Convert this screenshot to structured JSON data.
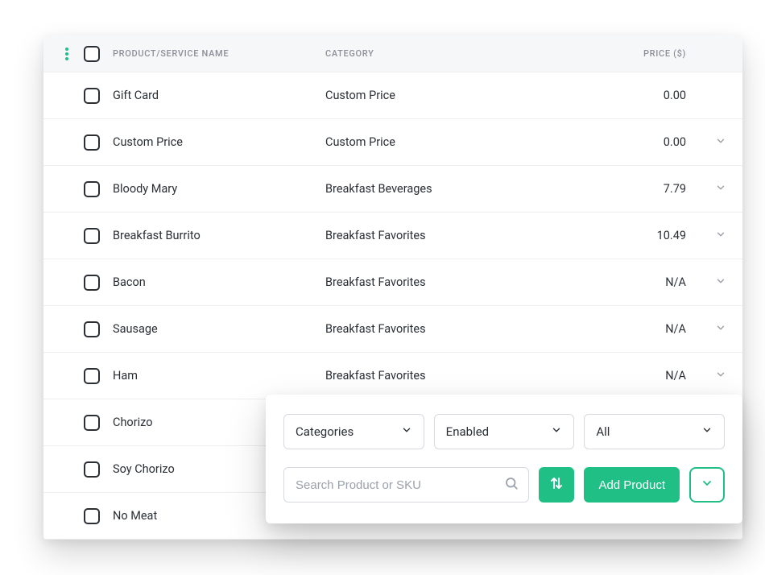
{
  "table": {
    "headers": {
      "name": "PRODUCT/SERVICE NAME",
      "category": "CATEGORY",
      "price": "PRICE ($)"
    },
    "rows": [
      {
        "name": "Gift Card",
        "category": "Custom Price",
        "price": "0.00",
        "expandable": false
      },
      {
        "name": "Custom Price",
        "category": "Custom Price",
        "price": "0.00",
        "expandable": true
      },
      {
        "name": "Bloody Mary",
        "category": "Breakfast Beverages",
        "price": "7.79",
        "expandable": true
      },
      {
        "name": "Breakfast Burrito",
        "category": "Breakfast Favorites",
        "price": "10.49",
        "expandable": true
      },
      {
        "name": "Bacon",
        "category": "Breakfast Favorites",
        "price": "N/A",
        "expandable": true
      },
      {
        "name": "Sausage",
        "category": "Breakfast Favorites",
        "price": "N/A",
        "expandable": true
      },
      {
        "name": "Ham",
        "category": "Breakfast Favorites",
        "price": "N/A",
        "expandable": true
      },
      {
        "name": "Chorizo",
        "category": "",
        "price": "",
        "expandable": false
      },
      {
        "name": "Soy Chorizo",
        "category": "",
        "price": "",
        "expandable": false
      },
      {
        "name": "No Meat",
        "category": "",
        "price": "",
        "expandable": false
      }
    ]
  },
  "toolbar": {
    "filters": {
      "categories": "Categories",
      "status": "Enabled",
      "scope": "All"
    },
    "search_placeholder": "Search Product or SKU",
    "add_label": "Add Product"
  },
  "colors": {
    "accent": "#1fbf85"
  }
}
